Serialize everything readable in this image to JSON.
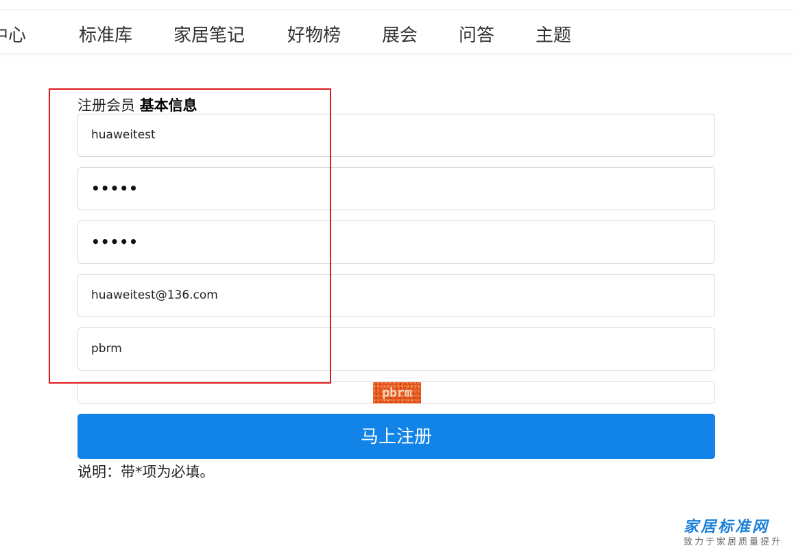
{
  "nav": {
    "items": [
      {
        "label": "中心"
      },
      {
        "label": "标准库"
      },
      {
        "label": "家居笔记"
      },
      {
        "label": "好物榜"
      },
      {
        "label": "展会"
      },
      {
        "label": "问答"
      },
      {
        "label": "主题"
      }
    ]
  },
  "form": {
    "title_prefix": "注册会员",
    "title_bold": "基本信息",
    "username": "huaweitest",
    "password": "•••••",
    "confirm_password": "•••••",
    "email": "huaweitest@136.com",
    "captcha_input": "pbrm",
    "captcha_image_text": "pbrm",
    "submit_label": "马上注册",
    "note": "说明：带*项为必填。"
  },
  "watermark": {
    "title": "家居标准网",
    "subtitle": "致力于家居质量提升"
  },
  "colors": {
    "primary": "#1284e7",
    "highlight": "#e01818",
    "captcha_bg": "#e8561f"
  }
}
